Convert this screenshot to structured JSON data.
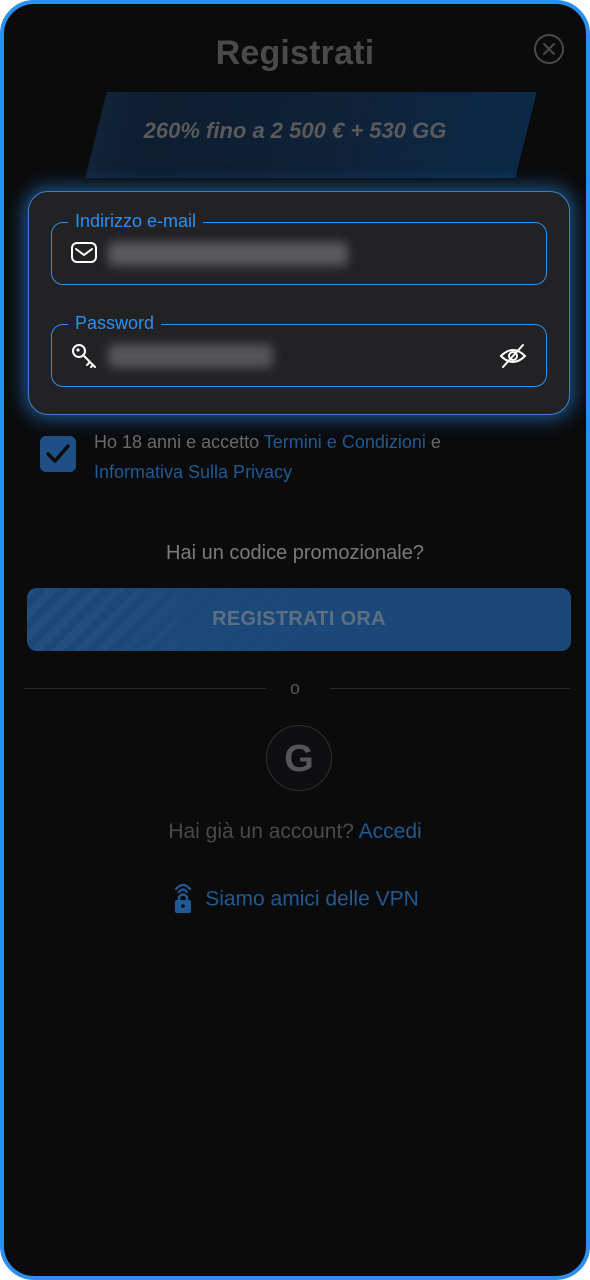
{
  "header": {
    "title": "Registrati",
    "close_icon": "close-icon"
  },
  "banner": {
    "text": "260% fino a 2 500 € + 530 GG"
  },
  "form": {
    "email": {
      "label": "Indirizzo e-mail",
      "icon": "envelope-icon",
      "value_blurred": true
    },
    "password": {
      "label": "Password",
      "icon": "key-icon",
      "value_blurred": true,
      "toggle_icon": "eye-off-icon"
    }
  },
  "terms": {
    "checked": true,
    "prefix": "Ho 18 anni e accetto ",
    "link1": "Termini e Condizioni",
    "middle": " e ",
    "link2": "Informativa Sulla Privacy"
  },
  "promo": {
    "text": "Hai un codice promozionale?"
  },
  "cta": {
    "label": "REGISTRATI ORA"
  },
  "divider": {
    "text": "o"
  },
  "google": {
    "icon": "google-icon",
    "glyph": "G"
  },
  "login": {
    "prompt": "Hai già un account? ",
    "link": "Accedi"
  },
  "vpn": {
    "text": "Siamo amici delle VPN",
    "icon": "vpn-lock-icon"
  },
  "colors": {
    "accent": "#2a8ff0",
    "background": "#0b0b0c",
    "card": "#222224"
  }
}
